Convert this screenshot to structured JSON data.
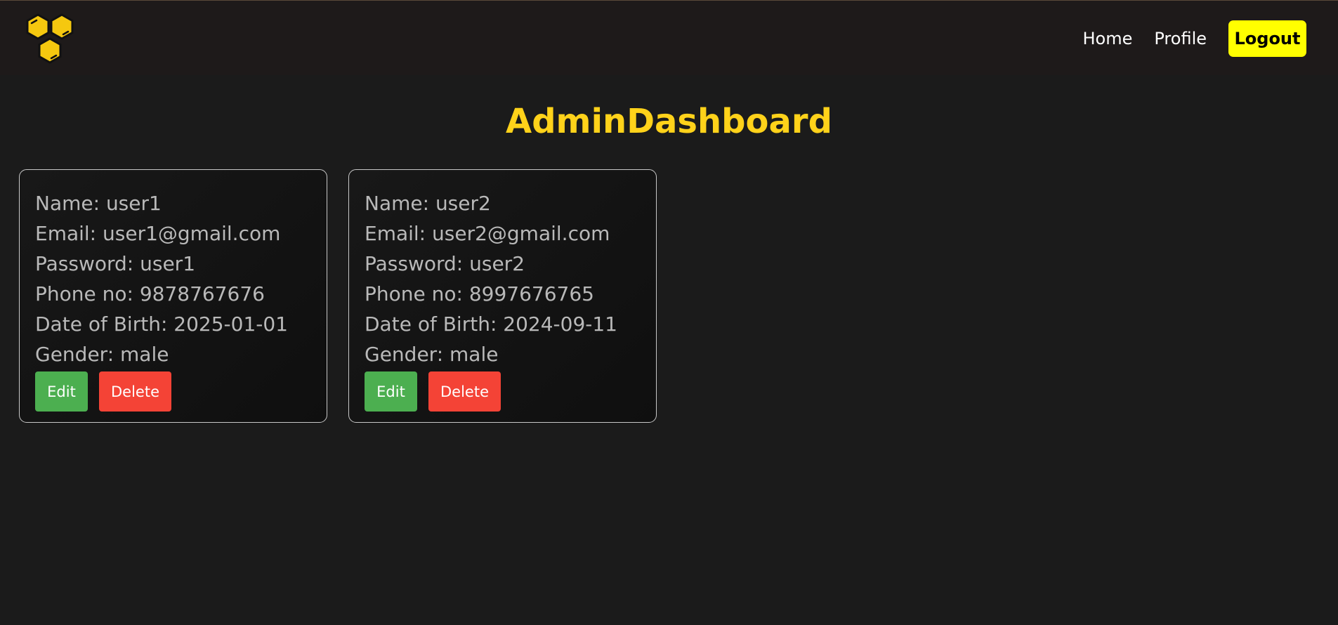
{
  "nav": {
    "logo_icon": "honeycomb-logo-icon",
    "links": [
      {
        "label": "Home"
      },
      {
        "label": "Profile"
      }
    ],
    "logout_label": "Logout"
  },
  "page": {
    "title": "AdminDashboard"
  },
  "users": [
    {
      "name": "Name: user1",
      "email": "Email: user1@gmail.com",
      "password": "Password: user1",
      "phone": "Phone no: 9878767676",
      "dob": "Date of Birth: 2025-01-01",
      "gender": "Gender: male",
      "edit_label": "Edit",
      "delete_label": "Delete"
    },
    {
      "name": "Name: user2",
      "email": "Email: user2@gmail.com",
      "password": "Password: user2",
      "phone": "Phone no: 8997676765",
      "dob": "Date of Birth: 2024-09-11",
      "gender": "Gender: male",
      "edit_label": "Edit",
      "delete_label": "Delete"
    }
  ],
  "colors": {
    "background": "#1b1b1b",
    "accent_yellow": "#ffd21a",
    "logout_bg": "#ffff00",
    "edit_bg": "#4caf50",
    "delete_bg": "#f44336"
  }
}
